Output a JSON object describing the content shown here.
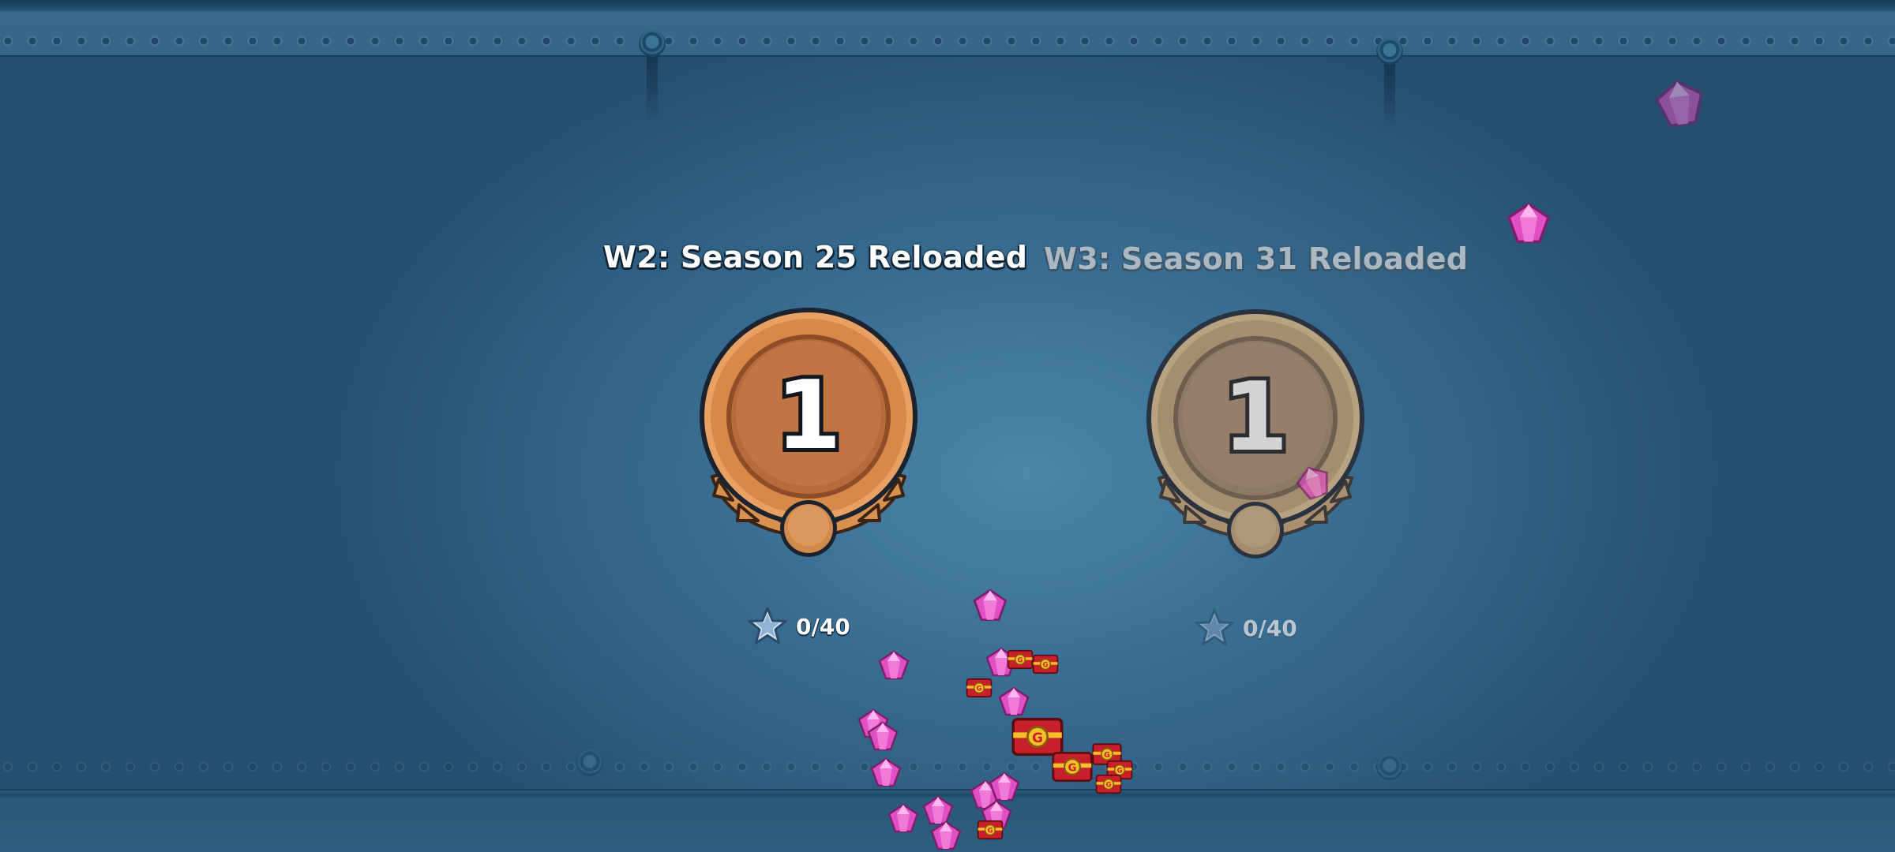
{
  "seasons": [
    {
      "title": "W2: Season 25 Reloaded",
      "rank": "1",
      "progress": "0/40",
      "state": "active"
    },
    {
      "title": "W3: Season 31 Reloaded",
      "rank": "1",
      "progress": "0/40",
      "state": "inactive"
    }
  ],
  "icons": {
    "progress": "star-icon",
    "reward_gem": "gem-icon",
    "reward_chest": "gear-chest-icon"
  },
  "colors": {
    "background": "#3a6f95",
    "medal_bronze": "#d08a4e",
    "medal_bronze_dark": "#a0592e",
    "medal_muted": "#a98f6f",
    "gem_pink": "#e04fc4",
    "chest_red": "#c8202a",
    "chest_gold": "#f2c028"
  }
}
